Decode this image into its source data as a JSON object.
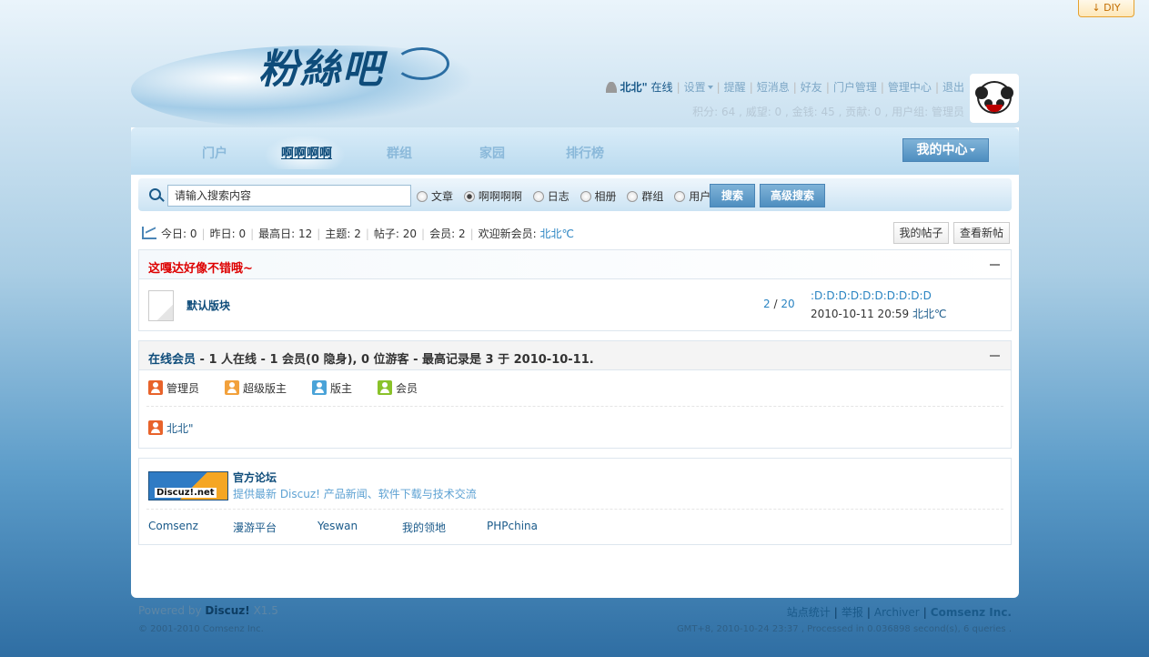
{
  "diy": {
    "label": "DIY",
    "icon": "arrow-down-icon"
  },
  "logo": {
    "text": "粉絲吧"
  },
  "user": {
    "name": "北北\"",
    "status": "在线",
    "links": [
      "设置",
      "提醒",
      "短消息",
      "好友",
      "门户管理",
      "管理中心",
      "退出"
    ],
    "credits": "积分: 64 , 威望: 0 , 金钱: 45 , 贡献: 0 , 用户组: 管理员"
  },
  "nav": {
    "items": [
      "门户",
      "啊啊啊啊",
      "群组",
      "家园",
      "排行榜"
    ],
    "active_index": 1,
    "my_center": "我的中心"
  },
  "search": {
    "placeholder": "请输入搜索内容",
    "options": [
      "文章",
      "啊啊啊啊",
      "日志",
      "相册",
      "群组",
      "用户"
    ],
    "selected_index": 1,
    "search_button": "搜索",
    "advanced_button": "高级搜索"
  },
  "stats": {
    "today_label": "今日:",
    "today": "0",
    "yesterday_label": "昨日:",
    "yesterday": "0",
    "max_label": "最高日:",
    "max": "12",
    "topics_label": "主题:",
    "topics": "2",
    "posts_label": "帖子:",
    "posts": "20",
    "members_label": "会员:",
    "members": "2",
    "welcome_label": "欢迎新会员:",
    "new_member": "北北℃",
    "my_posts_button": "我的帖子",
    "new_posts_button": "查看新帖"
  },
  "category": {
    "title": "这嘎达好像不错哦~",
    "title_color": "#dd0000",
    "forum": {
      "name": "默认版块",
      "topics": "2",
      "slash": "/",
      "posts": "20",
      "last_post_title": ":D:D:D:D:D:D:D:D:D:D",
      "last_post_time": "2010-10-11 20:59",
      "last_post_user": "北北℃"
    }
  },
  "online": {
    "title_link": "在线会员",
    "summary": " - 1 人在线 - 1 会员(0 隐身), 0 位游客 - 最高记录是 3 于 2010-10-11.",
    "legend": [
      {
        "label": "管理员",
        "color": "#e8632b",
        "icon": "admin-user-icon"
      },
      {
        "label": "超级版主",
        "color": "#f2a13c",
        "icon": "super-moderator-icon"
      },
      {
        "label": "版主",
        "color": "#4aa3d8",
        "icon": "moderator-icon"
      },
      {
        "label": "会员",
        "color": "#8ac22a",
        "icon": "member-icon"
      }
    ],
    "users": [
      "北北\""
    ]
  },
  "links": {
    "official_logo_text": "Discuz!.net",
    "official_title": "官方论坛",
    "official_desc": "提供最新 Discuz! 产品新闻、软件下载与技术交流",
    "friends": [
      "Comsenz",
      "漫游平台",
      "Yeswan",
      "我的领地",
      "PHPchina"
    ]
  },
  "footer": {
    "powered_by": "Powered by",
    "product": "Discuz!",
    "version": "X1.5",
    "copyright": "© 2001-2010 Comsenz Inc.",
    "right_links": [
      "站点统计",
      "举报",
      "Archiver",
      "Comsenz Inc."
    ],
    "time_info": "GMT+8, 2010-10-24 23:37 , Processed in 0.036898 second(s), 6 queries ."
  }
}
